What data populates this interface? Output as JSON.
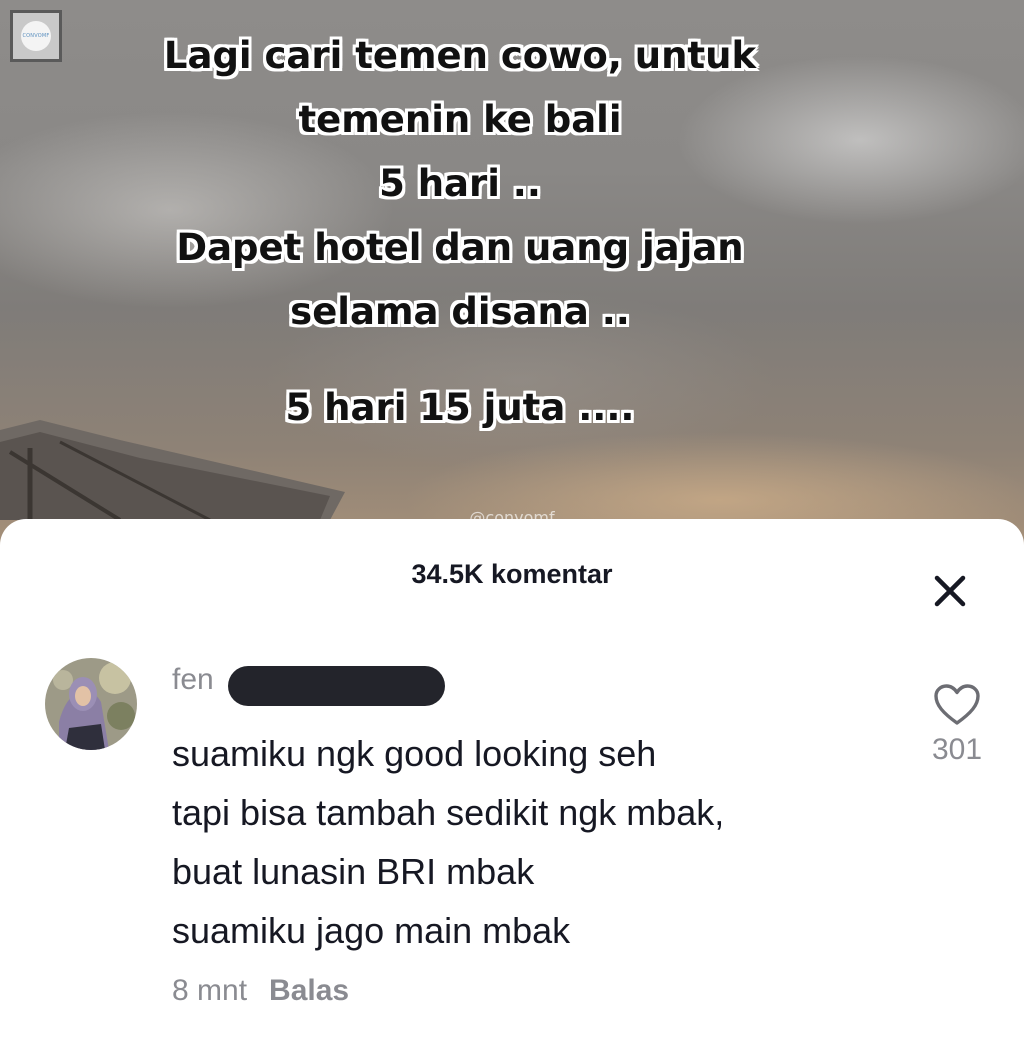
{
  "video": {
    "caption_lines": [
      "Lagi cari temen cowo, untuk",
      "temenin ke bali",
      "5 hari ..",
      "Dapet hotel dan uang jajan",
      "selama disana .."
    ],
    "caption_final": "5 hari 15 juta ....",
    "watermark": "@convomf",
    "logo_text": "CONVOMF"
  },
  "comments_sheet": {
    "title": "34.5K komentar",
    "close_icon": "close-icon"
  },
  "comment": {
    "username_visible": "fen",
    "lines": [
      "suamiku ngk good looking seh",
      "tapi bisa tambah sedikit ngk mbak,",
      "buat lunasin BRI mbak",
      "suamiku jago main mbak"
    ],
    "time": "8 mnt",
    "reply_label": "Balas",
    "like_count": "301",
    "like_icon": "heart-outline-icon"
  }
}
